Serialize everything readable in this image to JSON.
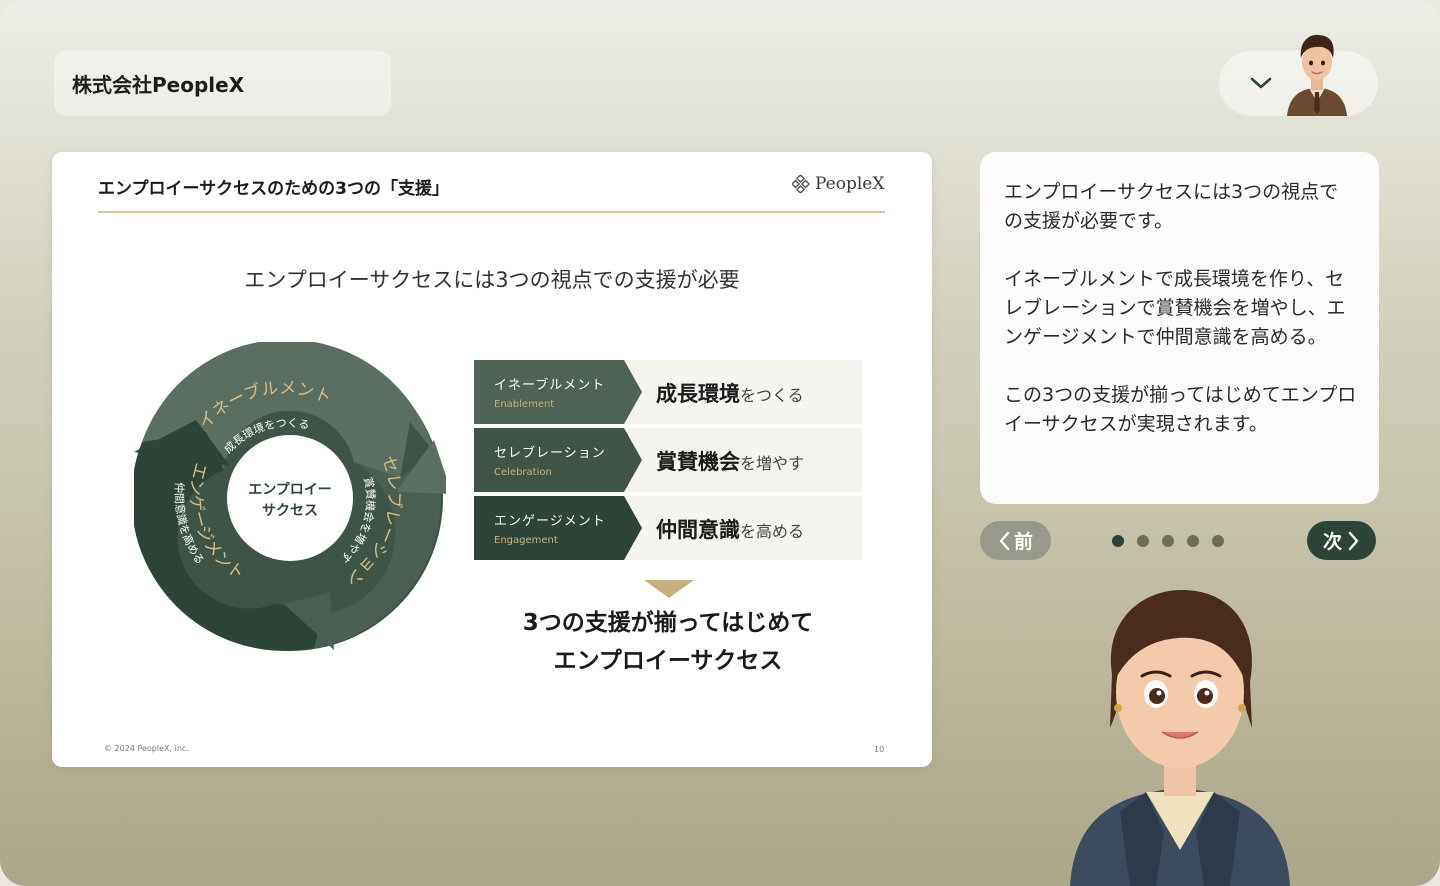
{
  "header": {
    "company_name": "株式会社PeopleX"
  },
  "user_menu": {
    "toggle_icon": "chevron-down-icon"
  },
  "slide": {
    "title": "エンプロイーサクセスのための3つの「支援」",
    "logo_text": "PeopleX",
    "lead": "エンプロイーサクセスには3つの視点での支援が必要",
    "cycle": {
      "center_line1": "エンプロイー",
      "center_line2": "サクセス",
      "segments": [
        {
          "title": "イネーブルメント",
          "sub": "成長環境をつくる"
        },
        {
          "title": "セレブレーション",
          "sub": "賞賛機会を増やす"
        },
        {
          "title": "エンゲージメント",
          "sub": "仲間意識を高める"
        }
      ]
    },
    "rows": [
      {
        "tag_jp": "イネーブルメント",
        "tag_en": "Enablement",
        "bold": "成長環境",
        "rest": "をつくる"
      },
      {
        "tag_jp": "セレブレーション",
        "tag_en": "Celebration",
        "bold": "賞賛機会",
        "rest": "を増やす"
      },
      {
        "tag_jp": "エンゲージメント",
        "tag_en": "Engagement",
        "bold": "仲間意識",
        "rest": "を高める"
      }
    ],
    "conclusion_line1": "3つの支援が揃ってはじめて",
    "conclusion_line2": "エンプロイーサクセス",
    "copyright": "© 2024 PeopleX, inc.",
    "page_number": "10"
  },
  "bubble": {
    "p1": "エンプロイーサクセスには3つの視点での支援が必要です。",
    "p2": "イネーブルメントで成長環境を作り、セレブレーションで賞賛機会を増やし、エンゲージメントで仲間意識を高める。",
    "p3": "この3つの支援が揃ってはじめてエンプロイーサクセスが実現されます。"
  },
  "nav": {
    "prev_label": "前",
    "next_label": "次",
    "total_pages": 5,
    "current_page": 1
  },
  "colors": {
    "accent_dark_green": "#2f4438",
    "gold": "#c7ae7f"
  }
}
